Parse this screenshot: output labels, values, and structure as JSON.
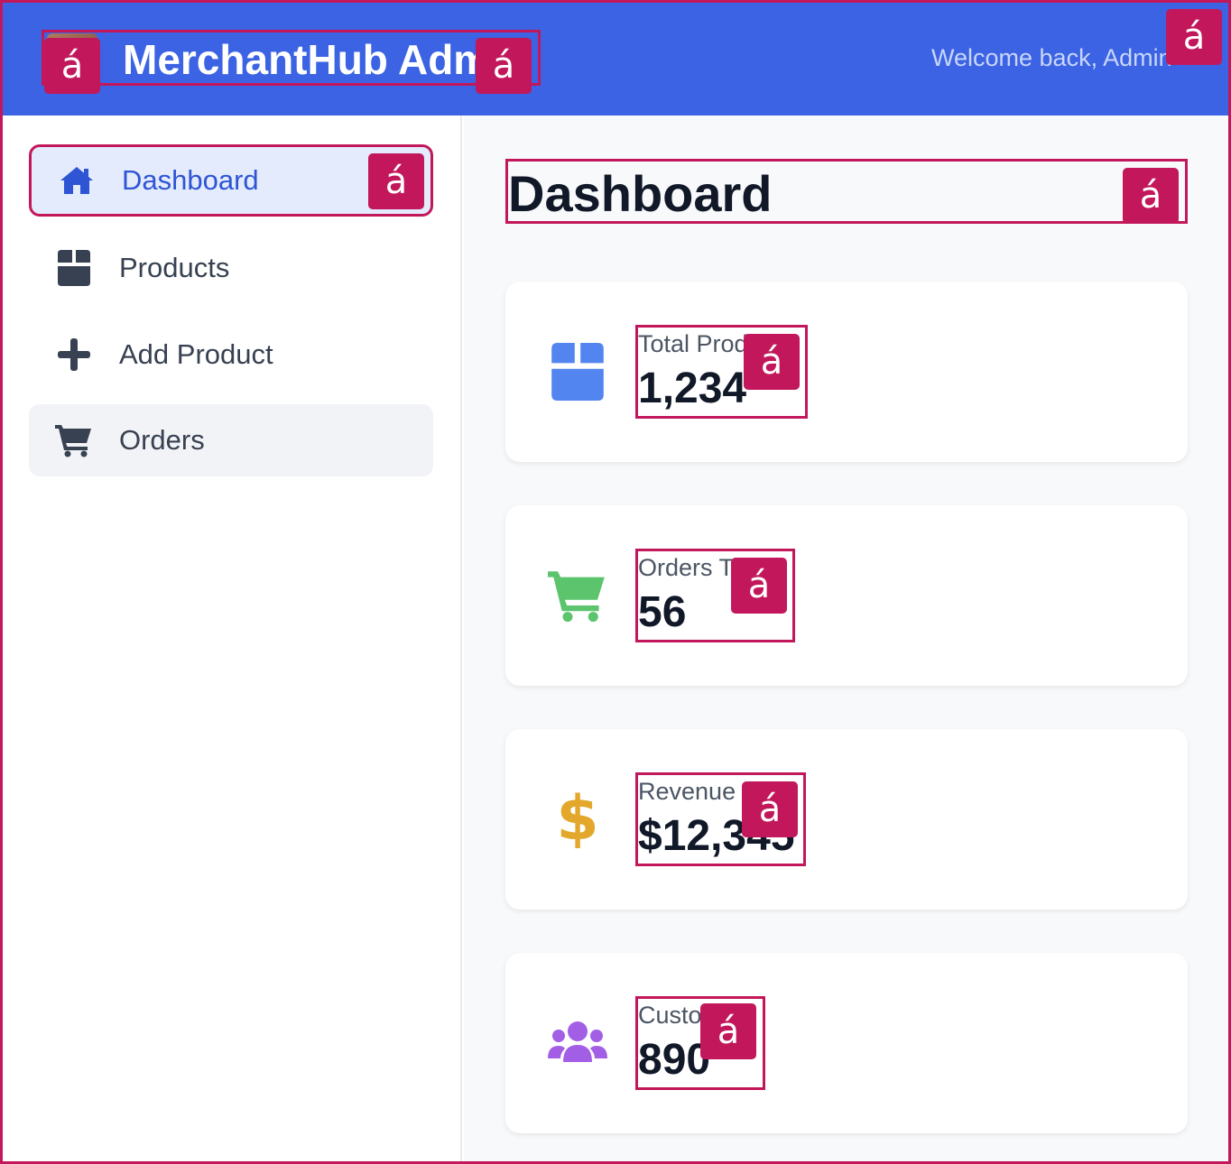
{
  "header": {
    "title": "MerchantHub Admin",
    "welcome": "Welcome back, Admin"
  },
  "sidebar": {
    "items": [
      {
        "label": "Dashboard",
        "icon": "home-icon",
        "active": true
      },
      {
        "label": "Products",
        "icon": "box-icon"
      },
      {
        "label": "Add Product",
        "icon": "plus-icon"
      },
      {
        "label": "Orders",
        "icon": "cart-icon"
      }
    ]
  },
  "main": {
    "title": "Dashboard",
    "stats": [
      {
        "label": "Total Products",
        "value": "1,234",
        "icon": "box-icon",
        "color": "#5385f0"
      },
      {
        "label": "Orders Today",
        "value": "56",
        "icon": "cart-icon",
        "color": "#5cc46c"
      },
      {
        "label": "Revenue",
        "value": "$12,345",
        "icon": "dollar-icon",
        "color": "#e3a82b"
      },
      {
        "label": "Customers",
        "value": "890",
        "icon": "users-icon",
        "color": "#a35ee6"
      }
    ]
  },
  "markers": {
    "glyph": "á"
  },
  "colors": {
    "header_bg": "#3b63e3",
    "marker": "#c2185b",
    "active_bg": "#e3ebfd",
    "active_text": "#2f55d4"
  }
}
